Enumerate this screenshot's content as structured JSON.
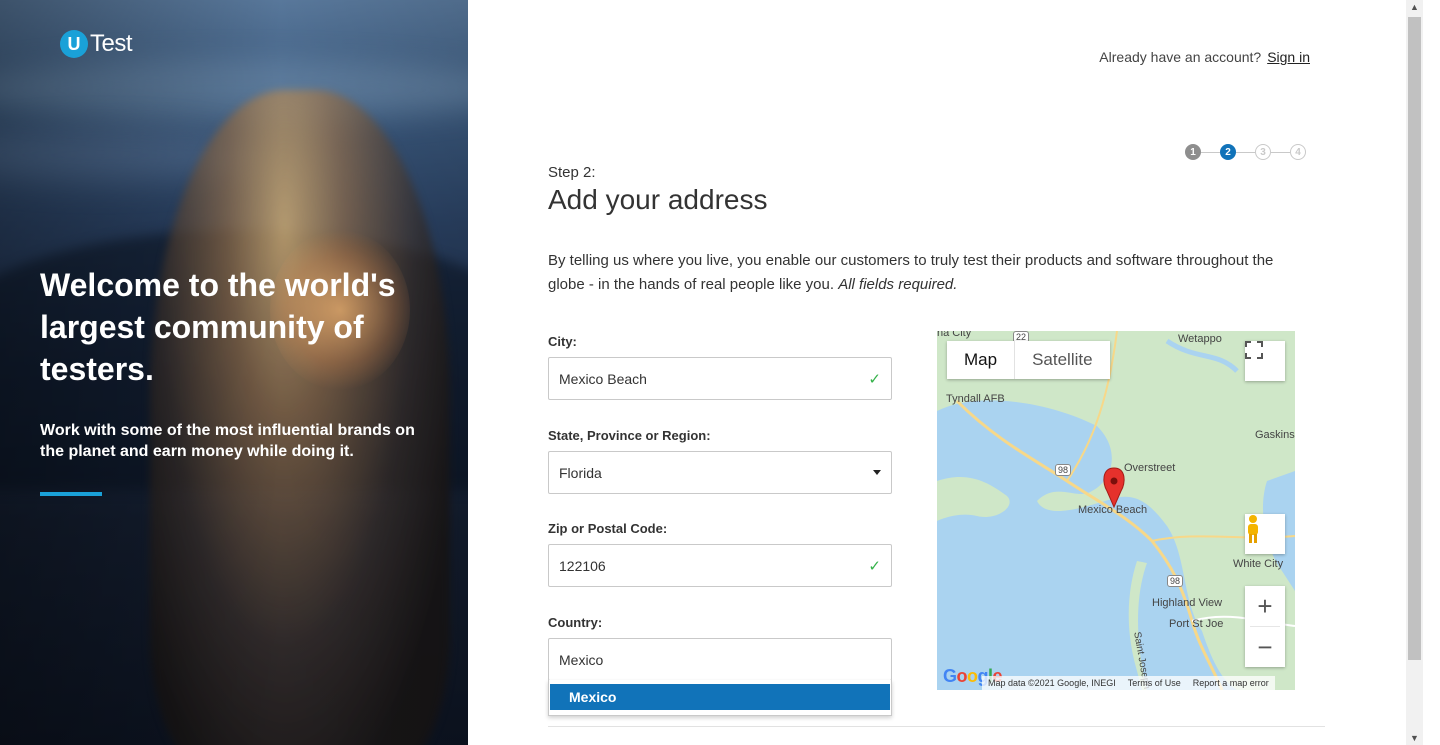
{
  "brand": {
    "logo_mark": "U",
    "logo_text": "Test"
  },
  "hero": {
    "headline": "Welcome to the world's largest community of testers.",
    "subtext": "Work with some of the most influential brands on the planet and earn money while doing it."
  },
  "header": {
    "account_prompt": "Already have an account?",
    "sign_in_label": "Sign in"
  },
  "stepper": {
    "steps": [
      "1",
      "2",
      "3",
      "4"
    ],
    "current": 2
  },
  "form": {
    "step_label": "Step 2:",
    "title": "Add your address",
    "intro_text": "By telling us where you live, you enable our customers to truly test their products and software throughout the globe - in the hands of real people like you.",
    "intro_emphasis": "All fields required.",
    "city": {
      "label": "City:",
      "value": "Mexico Beach"
    },
    "state": {
      "label": "State, Province or Region:",
      "value": "Florida"
    },
    "zip": {
      "label": "Zip or Postal Code:",
      "value": "122106"
    },
    "country": {
      "label": "Country:",
      "value": "Mexico",
      "suggestions": [
        "Mexico"
      ]
    }
  },
  "map": {
    "tab_map": "Map",
    "tab_satellite": "Satellite",
    "marker_label": "Mexico Beach",
    "places": [
      "na City",
      "Wetappo",
      "Tyndall AFB",
      "Gaskins",
      "Overstreet",
      "White City",
      "Highland View",
      "Port St Joe",
      "Saint Joseph"
    ],
    "road_shields": [
      "22",
      "98",
      "98"
    ],
    "logo_text": "Google",
    "attribution": "Map data ©2021 Google, INEGI",
    "terms": "Terms of Use",
    "report": "Report a map error",
    "zoom_in": "+",
    "zoom_out": "−",
    "colors": {
      "water": "#aad3f0",
      "land": "#cfe7c8",
      "road": "#f7d889",
      "marker": "#e5312c"
    }
  },
  "colors": {
    "accent": "#1173b9",
    "logo_blue": "#1aa1d8",
    "check_green": "#35b24a"
  }
}
